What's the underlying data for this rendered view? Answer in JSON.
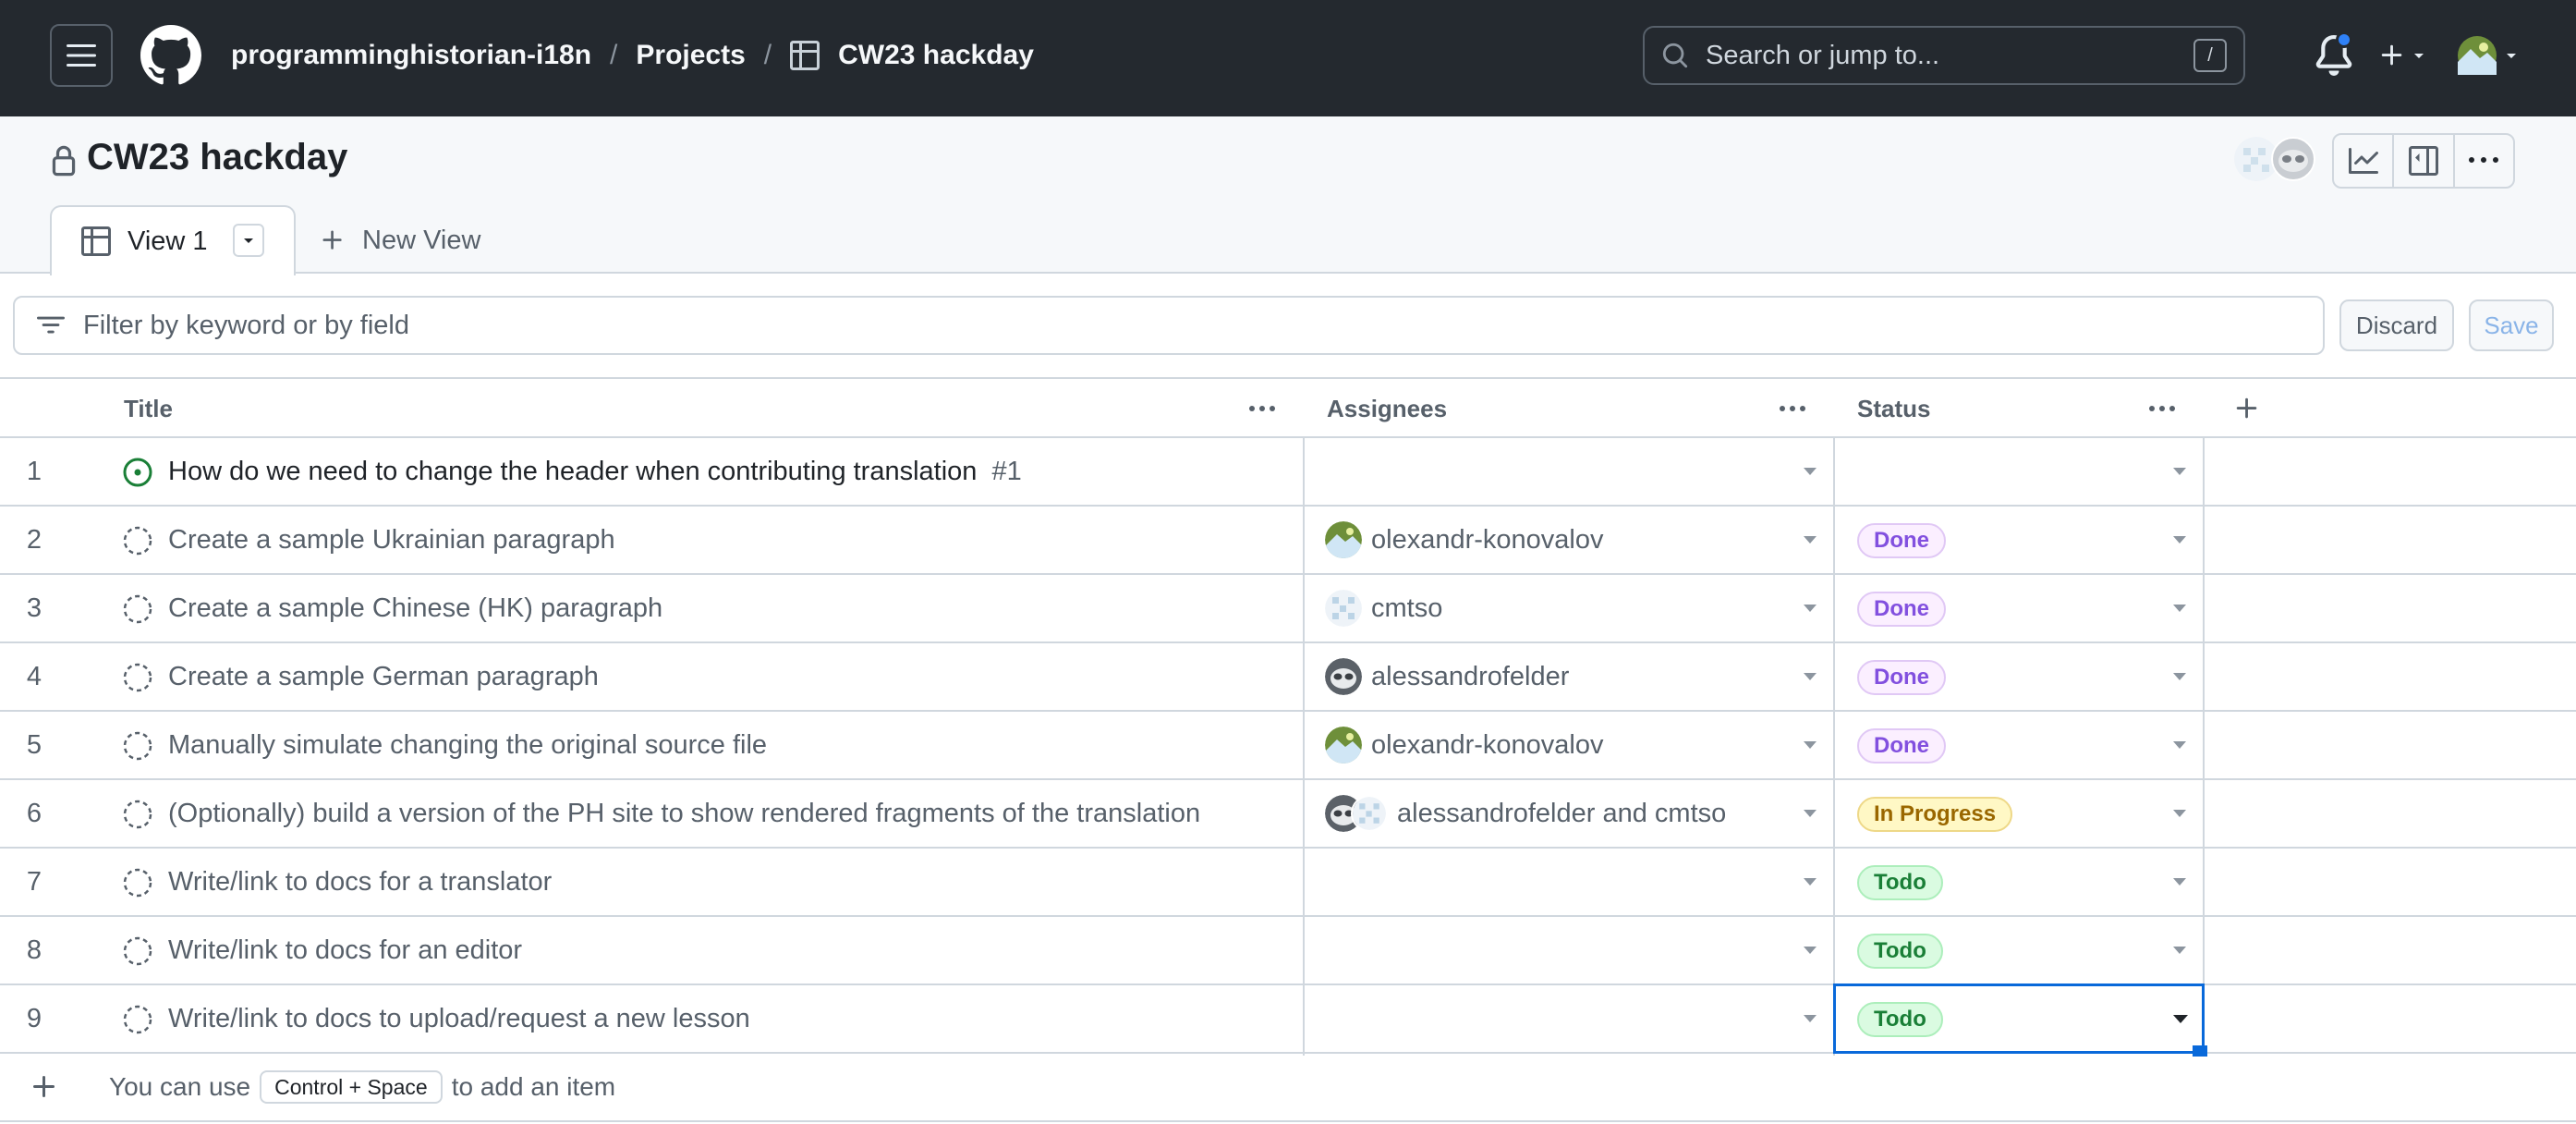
{
  "header": {
    "org": "programminghistorian-i18n",
    "projects_link": "Projects",
    "project_crumb": "CW23 hackday",
    "search_placeholder": "Search or jump to...",
    "search_shortcut": "/",
    "notification_color": "#2f81f7"
  },
  "project": {
    "title": "CW23 hackday",
    "active_tab": "View 1",
    "new_view": "New View"
  },
  "filter": {
    "placeholder": "Filter by keyword or by field",
    "discard_label": "Discard",
    "save_label": "Save"
  },
  "table": {
    "columns": {
      "title": "Title",
      "assignees": "Assignees",
      "status": "Status"
    },
    "rows": [
      {
        "num": "1",
        "title": "How do we need to change the header when contributing translation",
        "issue_ref": "#1",
        "assignees": "",
        "status": "",
        "state": "open"
      },
      {
        "num": "2",
        "title": "Create a sample Ukrainian paragraph",
        "assignees": "olexandr-konovalov",
        "status": "Done",
        "state": "draft"
      },
      {
        "num": "3",
        "title": "Create a sample Chinese (HK) paragraph",
        "assignees": "cmtso",
        "status": "Done",
        "state": "draft"
      },
      {
        "num": "4",
        "title": "Create a sample German paragraph",
        "assignees": "alessandrofelder",
        "status": "Done",
        "state": "draft"
      },
      {
        "num": "5",
        "title": "Manually simulate changing the original source file",
        "assignees": "olexandr-konovalov",
        "status": "Done",
        "state": "draft"
      },
      {
        "num": "6",
        "title": "(Optionally) build a version of the PH site to show rendered fragments of the translation",
        "assignees": "alessandrofelder and cmtso",
        "status": "In Progress",
        "state": "draft"
      },
      {
        "num": "7",
        "title": "Write/link to docs for a translator",
        "assignees": "",
        "status": "Todo",
        "state": "draft"
      },
      {
        "num": "8",
        "title": "Write/link to docs for an editor",
        "assignees": "",
        "status": "Todo",
        "state": "draft"
      },
      {
        "num": "9",
        "title": "Write/link to docs to upload/request a new lesson",
        "assignees": "",
        "status": "Todo",
        "state": "draft"
      }
    ],
    "add_item_hint_pre": "You can use",
    "add_item_kbd": "Control + Space",
    "add_item_hint_post": "to add an item"
  },
  "colors": {
    "done": "#8250df",
    "in_progress": "#9a6700",
    "todo": "#1a7f37",
    "selection": "#0969da"
  }
}
